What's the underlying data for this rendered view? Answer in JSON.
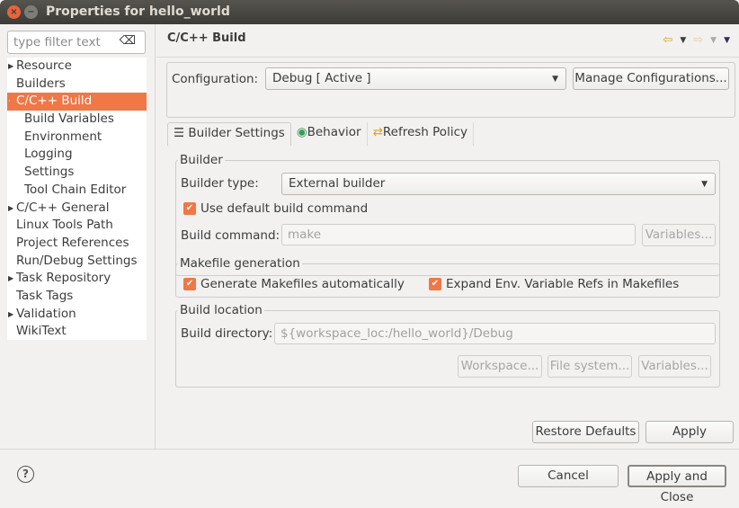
{
  "window": {
    "title": "Properties for hello_world",
    "close_icon": "×",
    "min_icon": "−"
  },
  "sidebar": {
    "filter_placeholder": "type filter text",
    "clear_icon": "⌫",
    "items": [
      {
        "label": "Resource",
        "expandable": true,
        "level": 0
      },
      {
        "label": "Builders",
        "level": 0
      },
      {
        "label": "C/C++ Build",
        "level": 0,
        "selected": true,
        "expanded": true
      },
      {
        "label": "Build Variables",
        "level": 1
      },
      {
        "label": "Environment",
        "level": 1
      },
      {
        "label": "Logging",
        "level": 1
      },
      {
        "label": "Settings",
        "level": 1
      },
      {
        "label": "Tool Chain Editor",
        "level": 1
      },
      {
        "label": "C/C++ General",
        "expandable": true,
        "level": 0
      },
      {
        "label": "Linux Tools Path",
        "level": 0
      },
      {
        "label": "Project References",
        "level": 0
      },
      {
        "label": "Run/Debug Settings",
        "level": 0
      },
      {
        "label": "Task Repository",
        "expandable": true,
        "level": 0
      },
      {
        "label": "Task Tags",
        "level": 0
      },
      {
        "label": "Validation",
        "expandable": true,
        "level": 0
      },
      {
        "label": "WikiText",
        "level": 0
      }
    ]
  },
  "main": {
    "title": "C/C++ Build",
    "config": {
      "label": "Configuration:",
      "value": "Debug  [ Active ]",
      "manage": "Manage Configurations..."
    },
    "tabs": [
      {
        "label": "Builder Settings",
        "icon": "☰"
      },
      {
        "label": "Behavior",
        "icon": "◉"
      },
      {
        "label": "Refresh Policy",
        "icon": "⇄"
      }
    ],
    "builder": {
      "legend": "Builder",
      "type_label": "Builder type:",
      "type_value": "External builder",
      "use_default": "Use default build command",
      "cmd_label": "Build command:",
      "cmd_value": "make",
      "variables": "Variables..."
    },
    "makefile": {
      "legend": "Makefile generation",
      "gen": "Generate Makefiles automatically",
      "expand": "Expand Env. Variable Refs in Makefiles"
    },
    "location": {
      "legend": "Build location",
      "dir_label": "Build directory:",
      "dir_value": "${workspace_loc:/hello_world}/Debug",
      "workspace": "Workspace...",
      "filesystem": "File system...",
      "variables": "Variables..."
    },
    "restore": "Restore Defaults",
    "apply": "Apply"
  },
  "footer": {
    "help": "?",
    "cancel": "Cancel",
    "apply_close": "Apply and Close"
  },
  "colors": {
    "accent": "#f07746",
    "titlebar": "#3c3b37"
  }
}
